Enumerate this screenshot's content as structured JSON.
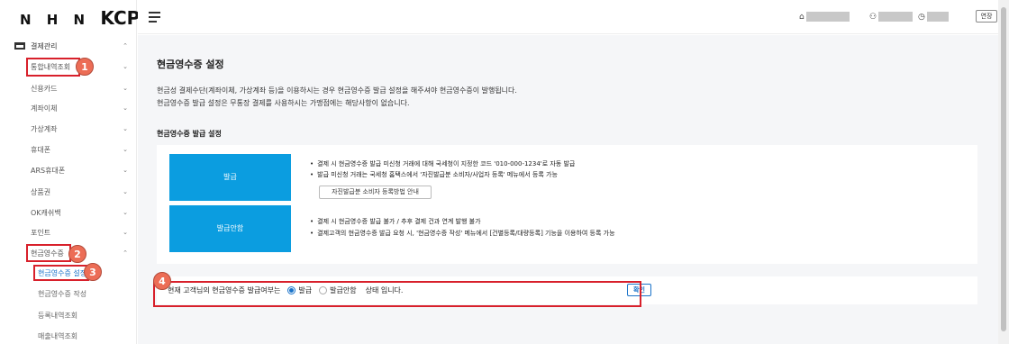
{
  "brand": {
    "prefix": "N H N",
    "name": "KCP"
  },
  "sidebar": {
    "top_menu": "결제관리",
    "items": [
      {
        "label": "통합내역조회"
      },
      {
        "label": "신용카드"
      },
      {
        "label": "계좌이체"
      },
      {
        "label": "가상계좌"
      },
      {
        "label": "휴대폰"
      },
      {
        "label": "ARS휴대폰"
      },
      {
        "label": "상품권"
      },
      {
        "label": "OK캐쉬백"
      },
      {
        "label": "포인트"
      },
      {
        "label": "현금영수증"
      }
    ],
    "submenu": [
      {
        "label": "현금영수증 설정"
      },
      {
        "label": "현금영수증 작성"
      },
      {
        "label": "등록내역조회"
      },
      {
        "label": "매출내역조회"
      }
    ]
  },
  "badges": [
    "1",
    "2",
    "3",
    "4"
  ],
  "header": {
    "extend_label": "연장"
  },
  "page": {
    "title": "현금영수증 설정",
    "desc1": "현금성 결제수단(계좌이체, 가상계좌 등)을 이용하시는 경우 현금영수증 발급 설정을 해주셔야 현금영수증이 발행됩니다.",
    "desc2": "현금영수증 발급 설정은 무통장 결제를 사용하시는 가맹점에는 해당사항이 없습니다.",
    "section_title": "현금영수증 발급 설정",
    "issue": {
      "label": "발급",
      "bullet1": "결제 시 현금영수증 발급 미신청 거래에 대해 국세청이 지정한 코드 '010-000-1234'로 자동 발급",
      "bullet2": "발급 미신청 거래는 국세청 홈택스에서 '자진발급분 소비자/사업자 등록' 메뉴에서 등록 가능",
      "guide_button": "자진발급분 소비자 등록방법 안내"
    },
    "no_issue": {
      "label": "발급안함",
      "bullet1": "결제 시 현금영수증 발급 불가 / 추후 결제 건과 연계 발행 불가",
      "bullet2": "결제고객의 현금영수증 발급 요청 시, '현금영수증 작성' 메뉴에서 [건별등록/대량등록] 기능을 이용하여 등록 가능"
    },
    "status": {
      "prefix": "현재 고객님의 현금영수증 발급여부는",
      "option_issue": "발급",
      "option_no_issue": "발급안함",
      "selected": "발급",
      "suffix": "상태 입니다.",
      "confirm_label": "확인"
    }
  },
  "colors": {
    "accent": "#0b9de0",
    "highlight": "#d8202b",
    "badge": "#ec6d56",
    "link": "#1a73c9"
  }
}
